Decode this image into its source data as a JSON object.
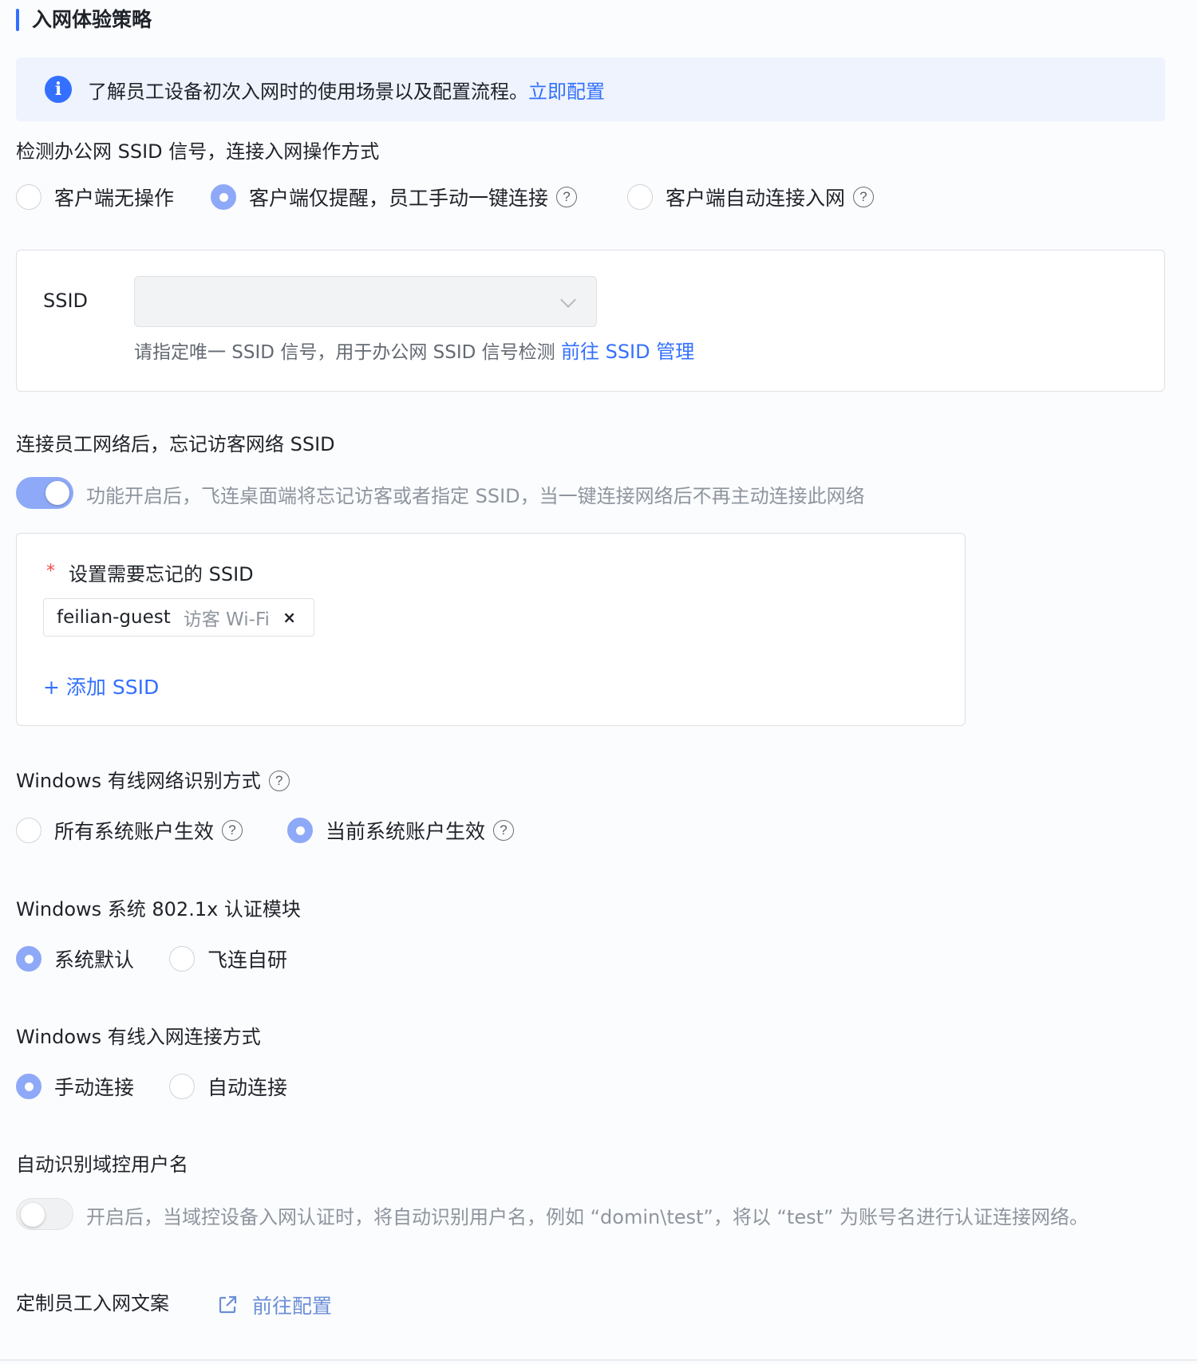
{
  "page": {
    "title": "入网体验策略"
  },
  "notice": {
    "text": "了解员工设备初次入网时的使用场景以及配置流程。",
    "link": "立即配置"
  },
  "ssid_detect": {
    "label": "检测办公网 SSID 信号，连接入网操作方式",
    "options": [
      "客户端无操作",
      "客户端仅提醒，员工手动一键连接",
      "客户端自动连接入网"
    ],
    "selected": "客户端仅提醒，员工手动一键连接",
    "field_label": "SSID",
    "select_value": "",
    "hint": "请指定唯一 SSID 信号，用于办公网 SSID 信号检测",
    "hint_link": "前往 SSID 管理"
  },
  "forget_guest": {
    "label": "连接员工网络后，忘记访客网络 SSID",
    "enabled": true,
    "desc": "功能开启后，飞连桌面端将忘记访客或者指定 SSID，当一键连接网络后不再主动连接此网络",
    "required_mark": "*",
    "field_label": "设置需要忘记的 SSID",
    "tag": {
      "name": "feilian-guest",
      "desc": "访客 Wi-Fi",
      "close": "×"
    },
    "add_link": "+ 添加 SSID"
  },
  "win_wired_identify": {
    "label": "Windows 有线网络识别方式",
    "options": [
      "所有系统账户生效",
      "当前系统账户生效"
    ],
    "selected": "当前系统账户生效"
  },
  "win_8021x": {
    "label": "Windows 系统 802.1x 认证模块",
    "options": [
      "系统默认",
      "飞连自研"
    ],
    "selected": "系统默认"
  },
  "win_wired_connect": {
    "label": "Windows 有线入网连接方式",
    "options": [
      "手动连接",
      "自动连接"
    ],
    "selected": "手动连接"
  },
  "domain_username": {
    "label": "自动识别域控用户名",
    "enabled": false,
    "desc": "开启后，当域控设备入网认证时，将自动识别用户名，例如 “domin\\test”，将以 “test” 为账号名进行认证连接网络。"
  },
  "custom_copy": {
    "label": "定制员工入网文案",
    "link": "前往配置"
  },
  "help_glyph": "?",
  "info_glyph": "i",
  "colors": {
    "accent": "#3370ff",
    "toggle_on": "#8ea9f7",
    "required": "#f54a45"
  }
}
